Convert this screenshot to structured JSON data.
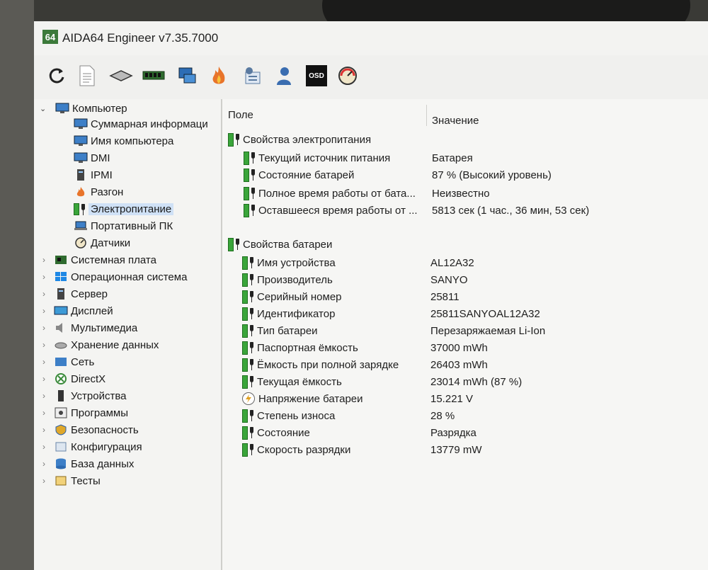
{
  "window": {
    "logo": "64",
    "title": "AIDA64 Engineer v7.35.7000"
  },
  "toolbar": {
    "buttons": [
      "refresh-icon",
      "report-icon",
      "drive-icon",
      "memory-icon",
      "network-icon",
      "flame-icon",
      "tools-icon",
      "user-icon",
      "osd-icon",
      "gauge-icon"
    ],
    "osd_label": "OSD"
  },
  "tree": {
    "root": "Компьютер",
    "children": [
      "Суммарная информаци",
      "Имя компьютера",
      "DMI",
      "IPMI",
      "Разгон",
      "Электропитание",
      "Портативный ПК",
      "Датчики"
    ],
    "selected_index": 5,
    "top_level": [
      "Системная плата",
      "Операционная система",
      "Сервер",
      "Дисплей",
      "Мультимедиа",
      "Хранение данных",
      "Сеть",
      "DirectX",
      "Устройства",
      "Программы",
      "Безопасность",
      "Конфигурация",
      "База данных",
      "Тесты"
    ]
  },
  "table": {
    "col_field": "Поле",
    "col_value": "Значение",
    "sections": [
      {
        "title": "Свойства электропитания",
        "rows": [
          {
            "field": "Текущий источник питания",
            "value": "Батарея"
          },
          {
            "field": "Состояние батарей",
            "value": "87 % (Высокий уровень)"
          },
          {
            "field": "Полное время работы от бата...",
            "value": "Неизвестно"
          },
          {
            "field": "Оставшееся время работы от ...",
            "value": "5813 сек (1 час., 36 мин, 53 сек)"
          }
        ]
      },
      {
        "title": "Свойства батареи",
        "rows": [
          {
            "field": "Имя устройства",
            "value": "AL12A32"
          },
          {
            "field": "Производитель",
            "value": "SANYO"
          },
          {
            "field": "Серийный номер",
            "value": "25811"
          },
          {
            "field": "Идентификатор",
            "value": "25811SANYOAL12A32"
          },
          {
            "field": "Тип батареи",
            "value": "Перезаряжаемая Li-Ion"
          },
          {
            "field": "Паспортная ёмкость",
            "value": "37000 mWh"
          },
          {
            "field": "Ёмкость при полной зарядке",
            "value": "26403 mWh"
          },
          {
            "field": "Текущая ёмкость",
            "value": "23014 mWh  (87 %)"
          },
          {
            "field": "Напряжение батареи",
            "value": "15.221 V"
          },
          {
            "field": "Степень износа",
            "value": "28 %"
          },
          {
            "field": "Состояние",
            "value": "Разрядка"
          },
          {
            "field": "Скорость разрядки",
            "value": "13779 mW"
          }
        ]
      }
    ]
  },
  "colors": {
    "selection": "#cfe1f6",
    "battery_green": "#3aa53a",
    "logo_green": "#3c7a3a"
  }
}
